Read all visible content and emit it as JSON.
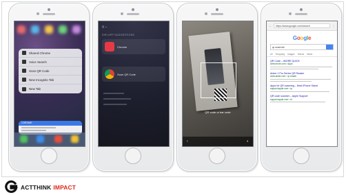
{
  "phones": [
    {
      "menu_items": [
        {
          "label": "Voice Search",
          "icon": "mic-icon"
        },
        {
          "label": "Scan QR Code",
          "icon": "qr-icon"
        },
        {
          "label": "New Incognito Tab",
          "icon": "incognito-icon"
        },
        {
          "label": "New Tab",
          "icon": "plus-icon"
        }
      ],
      "top_item": {
        "label": "Shared Chrome",
        "icon": "share-icon"
      },
      "card_head": "CHROME"
    },
    {
      "search_text": "Q ⌄",
      "section_label": "SIRI APP SUGGESTIONS",
      "rows": [
        {
          "name": "Chrome",
          "color": "#e63946"
        },
        {
          "name": "Scan QR Code",
          "color": "#ffffff"
        }
      ]
    },
    {
      "hint": "QR code or bar code"
    },
    {
      "url": "https://www.google.com/search",
      "logo": "Google",
      "query": "qr scanner",
      "tabs": [
        "All",
        "Shopping",
        "Images",
        "Videos",
        "News"
      ],
      "results": [
        {
          "title": "QR Code – iMORE QUICK",
          "url": "www.imore.com › Apps"
        },
        {
          "title": "Anker 1 Pro Series QR Reader",
          "url": "www.anker.com › qr-reader"
        },
        {
          "title": "Apps for QR scanning – Best iPhone Stand",
          "url": "support.apple.com › qr"
        },
        {
          "title": "QR code scanner – Apple Support",
          "url": "support.apple.com › ht"
        }
      ]
    }
  ],
  "footer": {
    "brand_a": "ACTTHINK",
    "brand_b": "IMPACT",
    "logo_color": "#111111",
    "accent": "#e2231a"
  }
}
